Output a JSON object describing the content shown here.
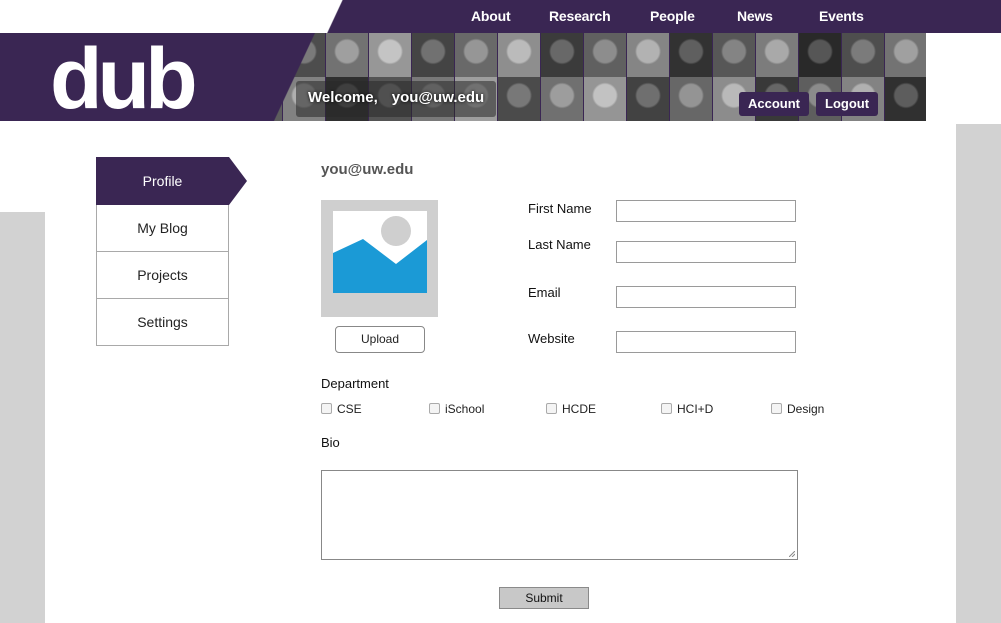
{
  "nav": {
    "items": [
      {
        "label": "About"
      },
      {
        "label": "Research"
      },
      {
        "label": "People"
      },
      {
        "label": "News"
      },
      {
        "label": "Events"
      }
    ]
  },
  "header": {
    "logo_text": "dub",
    "welcome_label": "Welcome,",
    "user_email": "you@uw.edu",
    "account_label": "Account",
    "logout_label": "Logout"
  },
  "sidebar": {
    "items": [
      {
        "label": "Profile",
        "active": true
      },
      {
        "label": "My Blog"
      },
      {
        "label": "Projects"
      },
      {
        "label": "Settings"
      }
    ]
  },
  "profile": {
    "title": "you@uw.edu",
    "upload_label": "Upload",
    "fields": {
      "first_name": {
        "label": "First Name",
        "value": ""
      },
      "last_name": {
        "label": "Last Name",
        "value": ""
      },
      "email": {
        "label": "Email",
        "value": ""
      },
      "website": {
        "label": "Website",
        "value": ""
      }
    },
    "department_label": "Department",
    "departments": [
      {
        "label": "CSE",
        "checked": false
      },
      {
        "label": "iSchool",
        "checked": false
      },
      {
        "label": "HCDE",
        "checked": false
      },
      {
        "label": "HCI+D",
        "checked": false
      },
      {
        "label": "Design",
        "checked": false
      }
    ],
    "bio_label": "Bio",
    "bio_value": "",
    "submit_label": "Submit"
  },
  "colors": {
    "brand_purple": "#3a2653",
    "side_gray": "#d2d2d2",
    "placeholder_blue": "#1b9ad6"
  },
  "icons": {
    "avatar": "image-placeholder-icon",
    "checkbox": "checkbox-icon",
    "textarea_resize": "resize-grip-icon"
  }
}
